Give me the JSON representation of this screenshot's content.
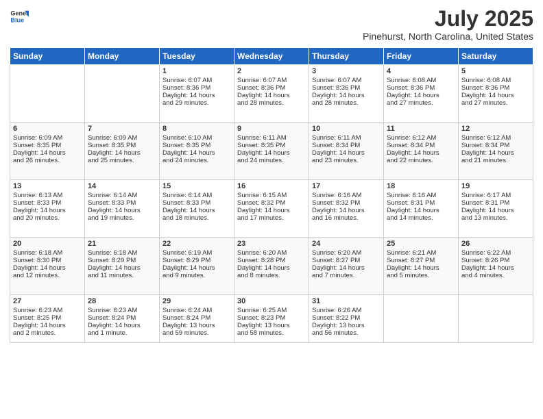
{
  "header": {
    "logo_general": "General",
    "logo_blue": "Blue",
    "month_year": "July 2025",
    "location": "Pinehurst, North Carolina, United States"
  },
  "days_of_week": [
    "Sunday",
    "Monday",
    "Tuesday",
    "Wednesday",
    "Thursday",
    "Friday",
    "Saturday"
  ],
  "weeks": [
    [
      {
        "day": "",
        "content": ""
      },
      {
        "day": "",
        "content": ""
      },
      {
        "day": "1",
        "content": "Sunrise: 6:07 AM\nSunset: 8:36 PM\nDaylight: 14 hours\nand 29 minutes."
      },
      {
        "day": "2",
        "content": "Sunrise: 6:07 AM\nSunset: 8:36 PM\nDaylight: 14 hours\nand 28 minutes."
      },
      {
        "day": "3",
        "content": "Sunrise: 6:07 AM\nSunset: 8:36 PM\nDaylight: 14 hours\nand 28 minutes."
      },
      {
        "day": "4",
        "content": "Sunrise: 6:08 AM\nSunset: 8:36 PM\nDaylight: 14 hours\nand 27 minutes."
      },
      {
        "day": "5",
        "content": "Sunrise: 6:08 AM\nSunset: 8:36 PM\nDaylight: 14 hours\nand 27 minutes."
      }
    ],
    [
      {
        "day": "6",
        "content": "Sunrise: 6:09 AM\nSunset: 8:35 PM\nDaylight: 14 hours\nand 26 minutes."
      },
      {
        "day": "7",
        "content": "Sunrise: 6:09 AM\nSunset: 8:35 PM\nDaylight: 14 hours\nand 25 minutes."
      },
      {
        "day": "8",
        "content": "Sunrise: 6:10 AM\nSunset: 8:35 PM\nDaylight: 14 hours\nand 24 minutes."
      },
      {
        "day": "9",
        "content": "Sunrise: 6:11 AM\nSunset: 8:35 PM\nDaylight: 14 hours\nand 24 minutes."
      },
      {
        "day": "10",
        "content": "Sunrise: 6:11 AM\nSunset: 8:34 PM\nDaylight: 14 hours\nand 23 minutes."
      },
      {
        "day": "11",
        "content": "Sunrise: 6:12 AM\nSunset: 8:34 PM\nDaylight: 14 hours\nand 22 minutes."
      },
      {
        "day": "12",
        "content": "Sunrise: 6:12 AM\nSunset: 8:34 PM\nDaylight: 14 hours\nand 21 minutes."
      }
    ],
    [
      {
        "day": "13",
        "content": "Sunrise: 6:13 AM\nSunset: 8:33 PM\nDaylight: 14 hours\nand 20 minutes."
      },
      {
        "day": "14",
        "content": "Sunrise: 6:14 AM\nSunset: 8:33 PM\nDaylight: 14 hours\nand 19 minutes."
      },
      {
        "day": "15",
        "content": "Sunrise: 6:14 AM\nSunset: 8:33 PM\nDaylight: 14 hours\nand 18 minutes."
      },
      {
        "day": "16",
        "content": "Sunrise: 6:15 AM\nSunset: 8:32 PM\nDaylight: 14 hours\nand 17 minutes."
      },
      {
        "day": "17",
        "content": "Sunrise: 6:16 AM\nSunset: 8:32 PM\nDaylight: 14 hours\nand 16 minutes."
      },
      {
        "day": "18",
        "content": "Sunrise: 6:16 AM\nSunset: 8:31 PM\nDaylight: 14 hours\nand 14 minutes."
      },
      {
        "day": "19",
        "content": "Sunrise: 6:17 AM\nSunset: 8:31 PM\nDaylight: 14 hours\nand 13 minutes."
      }
    ],
    [
      {
        "day": "20",
        "content": "Sunrise: 6:18 AM\nSunset: 8:30 PM\nDaylight: 14 hours\nand 12 minutes."
      },
      {
        "day": "21",
        "content": "Sunrise: 6:18 AM\nSunset: 8:29 PM\nDaylight: 14 hours\nand 11 minutes."
      },
      {
        "day": "22",
        "content": "Sunrise: 6:19 AM\nSunset: 8:29 PM\nDaylight: 14 hours\nand 9 minutes."
      },
      {
        "day": "23",
        "content": "Sunrise: 6:20 AM\nSunset: 8:28 PM\nDaylight: 14 hours\nand 8 minutes."
      },
      {
        "day": "24",
        "content": "Sunrise: 6:20 AM\nSunset: 8:27 PM\nDaylight: 14 hours\nand 7 minutes."
      },
      {
        "day": "25",
        "content": "Sunrise: 6:21 AM\nSunset: 8:27 PM\nDaylight: 14 hours\nand 5 minutes."
      },
      {
        "day": "26",
        "content": "Sunrise: 6:22 AM\nSunset: 8:26 PM\nDaylight: 14 hours\nand 4 minutes."
      }
    ],
    [
      {
        "day": "27",
        "content": "Sunrise: 6:23 AM\nSunset: 8:25 PM\nDaylight: 14 hours\nand 2 minutes."
      },
      {
        "day": "28",
        "content": "Sunrise: 6:23 AM\nSunset: 8:24 PM\nDaylight: 14 hours\nand 1 minute."
      },
      {
        "day": "29",
        "content": "Sunrise: 6:24 AM\nSunset: 8:24 PM\nDaylight: 13 hours\nand 59 minutes."
      },
      {
        "day": "30",
        "content": "Sunrise: 6:25 AM\nSunset: 8:23 PM\nDaylight: 13 hours\nand 58 minutes."
      },
      {
        "day": "31",
        "content": "Sunrise: 6:26 AM\nSunset: 8:22 PM\nDaylight: 13 hours\nand 56 minutes."
      },
      {
        "day": "",
        "content": ""
      },
      {
        "day": "",
        "content": ""
      }
    ]
  ]
}
